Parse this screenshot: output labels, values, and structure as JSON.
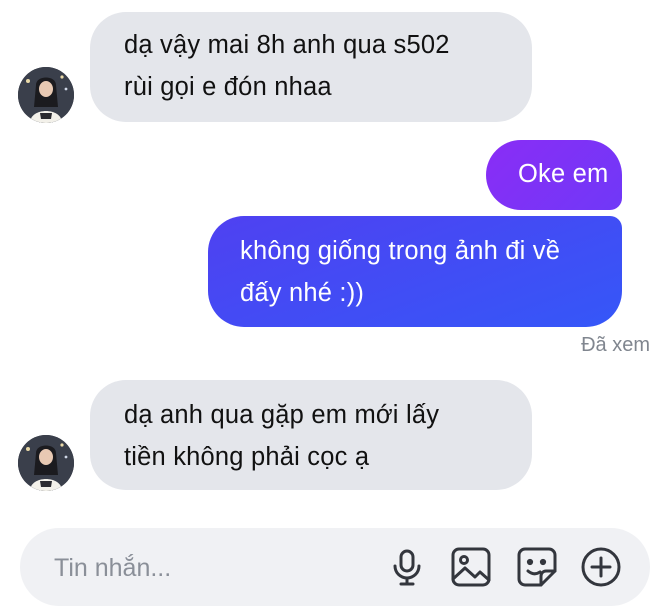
{
  "messages": [
    {
      "direction": "incoming",
      "text_lines": [
        "dạ vậy mai 8h anh qua s502",
        "rùi gọi e đón nhaa"
      ],
      "avatar_icon": "contact-avatar"
    },
    {
      "direction": "outgoing",
      "text_lines": [
        "Oke em"
      ]
    },
    {
      "direction": "outgoing",
      "text_lines": [
        "không giống trong ảnh đi về",
        "đấy nhé :))"
      ]
    },
    {
      "direction": "incoming",
      "text_lines": [
        "dạ anh qua gặp em mới lấy",
        "tiền không phải cọc ạ"
      ],
      "avatar_icon": "contact-avatar"
    }
  ],
  "seen_status": "Đã xem",
  "composer": {
    "placeholder": "Tin nhắn...",
    "value": "",
    "icons": [
      "microphone-icon",
      "image-icon",
      "sticker-icon",
      "add-icon"
    ]
  },
  "colors": {
    "incoming_bubble": "#e4e6eb",
    "outgoing_gradient_start": "#8a2df6",
    "outgoing_gradient_end": "#3557f8",
    "seen_text": "#80868f",
    "composer_bg": "#f0f1f4",
    "icon_stroke": "#33363d"
  }
}
